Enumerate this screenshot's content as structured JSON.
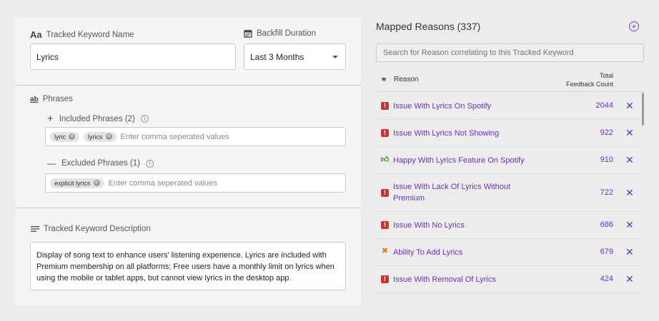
{
  "left": {
    "keyword_name": {
      "label": "Tracked Keyword Name",
      "icon_text": "Aa",
      "value": "Lyrics"
    },
    "backfill": {
      "label": "Backfill Duration",
      "value": "Last 3 Months"
    },
    "phrases": {
      "label": "Phrases",
      "icon_text": "ab",
      "included": {
        "label": "Included Phrases (2)",
        "sign": "+",
        "tags": [
          "lyric",
          "lyrics"
        ],
        "placeholder": "Enter comma seperated values"
      },
      "excluded": {
        "label": "Excluded Phrases (1)",
        "sign": "—",
        "tags": [
          "explicit lyrics"
        ],
        "placeholder": "Enter comma seperated values"
      }
    },
    "description": {
      "label": "Tracked Keyword Description",
      "value": "Display of song text to enhance users' listening experience. Lyrics are included with Premium membership on all platforms; Free users have a monthly limit on lyrics when using the mobile or tablet apps, but cannot view lyrics in the desktop app."
    }
  },
  "right": {
    "title": "Mapped Reasons (337)",
    "search_placeholder": "Search for Reason correlating to this Tracked Keyword",
    "columns": {
      "quote": "❞",
      "reason": "Reason",
      "count_line1": "Total",
      "count_line2": "Feedback Count"
    },
    "rows": [
      {
        "icon": "issue-icon",
        "type": "issue",
        "text": "Issue With Lyrics On Spotify",
        "count": "2044"
      },
      {
        "icon": "issue-icon",
        "type": "issue",
        "text": "Issue With Lyrics Not Showing",
        "count": "922"
      },
      {
        "icon": "thumbs-up-icon",
        "type": "happy",
        "text": "Happy With Lyrics Feature On Spotify",
        "count": "910"
      },
      {
        "icon": "issue-icon",
        "type": "issue",
        "text": "Issue With Lack Of Lyrics Without Premium",
        "count": "722"
      },
      {
        "icon": "issue-icon",
        "type": "issue",
        "text": "Issue With No Lyrics",
        "count": "686"
      },
      {
        "icon": "tools-icon",
        "type": "ability",
        "text": "Ability To Add Lyrics",
        "count": "679"
      },
      {
        "icon": "issue-icon",
        "type": "issue",
        "text": "Issue With Removal Of Lyrics",
        "count": "424"
      }
    ]
  },
  "colors": {
    "accent": "#6a31b8",
    "issue": "#d0332d",
    "happy": "#2e7d32",
    "ability": "#e0781a"
  }
}
